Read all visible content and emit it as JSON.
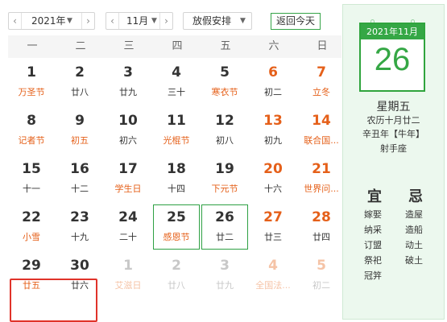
{
  "toolbar": {
    "year_value": "2021年",
    "month_value": "11月",
    "holiday_label": "放假安排",
    "today_label": "返回今天"
  },
  "weekdays": [
    "一",
    "二",
    "三",
    "四",
    "五",
    "六",
    "日"
  ],
  "weeks": [
    [
      {
        "day": "1",
        "sub": "万圣节",
        "fest": true
      },
      {
        "day": "2",
        "sub": "廿八"
      },
      {
        "day": "3",
        "sub": "廿九"
      },
      {
        "day": "4",
        "sub": "三十"
      },
      {
        "day": "5",
        "sub": "寒衣节",
        "fest": true
      },
      {
        "day": "6",
        "sub": "初二",
        "red": true
      },
      {
        "day": "7",
        "sub": "立冬",
        "red": true,
        "fest": true
      }
    ],
    [
      {
        "day": "8",
        "sub": "记者节",
        "fest": true
      },
      {
        "day": "9",
        "sub": "初五",
        "fest": true
      },
      {
        "day": "10",
        "sub": "初六"
      },
      {
        "day": "11",
        "sub": "光棍节",
        "fest": true
      },
      {
        "day": "12",
        "sub": "初八"
      },
      {
        "day": "13",
        "sub": "初九",
        "red": true
      },
      {
        "day": "14",
        "sub": "联合国...",
        "red": true,
        "fest": true
      }
    ],
    [
      {
        "day": "15",
        "sub": "十一"
      },
      {
        "day": "16",
        "sub": "十二"
      },
      {
        "day": "17",
        "sub": "学生日",
        "fest": true
      },
      {
        "day": "18",
        "sub": "十四"
      },
      {
        "day": "19",
        "sub": "下元节",
        "fest": true
      },
      {
        "day": "20",
        "sub": "十六",
        "red": true
      },
      {
        "day": "21",
        "sub": "世界问...",
        "red": true,
        "fest": true
      }
    ],
    [
      {
        "day": "22",
        "sub": "小雪",
        "fest": true
      },
      {
        "day": "23",
        "sub": "十九"
      },
      {
        "day": "24",
        "sub": "二十"
      },
      {
        "day": "25",
        "sub": "感恩节",
        "fest": true,
        "boxed": true
      },
      {
        "day": "26",
        "sub": "廿二",
        "boxed": true
      },
      {
        "day": "27",
        "sub": "廿三",
        "red": true
      },
      {
        "day": "28",
        "sub": "廿四",
        "red": true
      }
    ],
    [
      {
        "day": "29",
        "sub": "廿五",
        "fest": true
      },
      {
        "day": "30",
        "sub": "廿六"
      },
      {
        "day": "1",
        "sub": "艾滋日",
        "fest": true,
        "other": true
      },
      {
        "day": "2",
        "sub": "廿八",
        "other": true
      },
      {
        "day": "3",
        "sub": "廿九",
        "other": true
      },
      {
        "day": "4",
        "sub": "全国法...",
        "red": true,
        "fest": true,
        "other": true
      },
      {
        "day": "5",
        "sub": "初二",
        "red": true,
        "other": true
      }
    ]
  ],
  "panel": {
    "header": "2021年11月",
    "big_day": "26",
    "weekday": "星期五",
    "lunar": "农历十月廿二",
    "ganzhi": "辛丑年【牛年】",
    "zodiac": "射手座",
    "yi_title": "宜",
    "ji_title": "忌",
    "yi": [
      "嫁娶",
      "纳采",
      "订盟",
      "祭祀",
      "冠笄"
    ],
    "ji": [
      "造屋",
      "造船",
      "动土",
      "破土"
    ]
  },
  "colors": {
    "accent_green": "#35a745",
    "festival_orange": "#e5601a",
    "selection_red": "#e0332a"
  }
}
